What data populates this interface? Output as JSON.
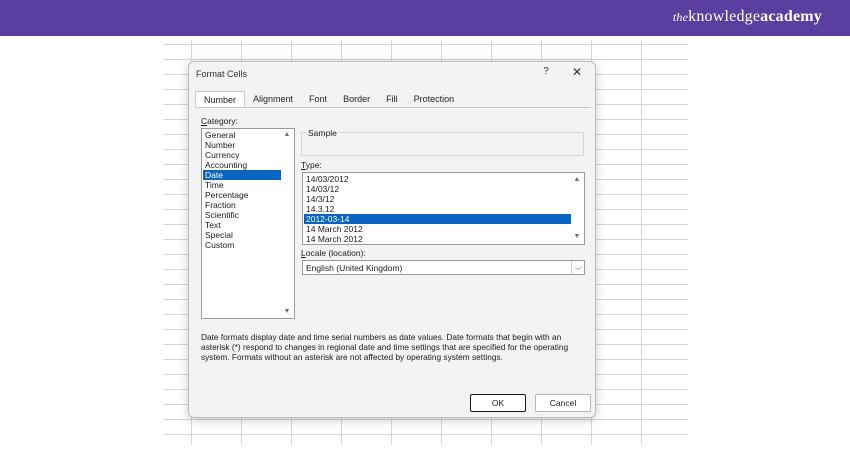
{
  "brand": {
    "prefix": "the",
    "main": "knowledge",
    "suffix": "academy"
  },
  "dialog": {
    "title": "Format Cells",
    "help_symbol": "?",
    "close_symbol": "✕",
    "tabs": [
      {
        "label": "Number",
        "active": true
      },
      {
        "label": "Alignment",
        "active": false
      },
      {
        "label": "Font",
        "active": false
      },
      {
        "label": "Border",
        "active": false
      },
      {
        "label": "Fill",
        "active": false
      },
      {
        "label": "Protection",
        "active": false
      }
    ],
    "category": {
      "label_underline": "C",
      "label_rest": "ategory:",
      "items": [
        "General",
        "Number",
        "Currency",
        "Accounting",
        "Date",
        "Time",
        "Percentage",
        "Fraction",
        "Scientific",
        "Text",
        "Special",
        "Custom"
      ],
      "selected": "Date"
    },
    "sample": {
      "label": "Sample"
    },
    "type": {
      "label_underline": "T",
      "label_rest": "ype:",
      "items": [
        "14/03/2012",
        "14/03/12",
        "14/3/12",
        "14.3.12",
        "2012-03-14",
        "14 March 2012",
        "14 March 2012"
      ],
      "selected_index": 4
    },
    "locale": {
      "label_underline": "L",
      "label_rest": "ocale (location):",
      "value": "English (United Kingdom)"
    },
    "description": "Date formats display date and time serial numbers as date values.  Date formats that begin with an asterisk (*) respond to changes in regional date and time settings that are specified for the operating system. Formats without an asterisk are not affected by operating system settings.",
    "ok_label": "OK",
    "cancel_label": "Cancel"
  },
  "icons": {
    "scroll_up": "▲",
    "scroll_down": "▼",
    "chevron_down": "⌵"
  },
  "colors": {
    "brand_bar": "#5b3fa0",
    "selection": "#0a64c2"
  }
}
